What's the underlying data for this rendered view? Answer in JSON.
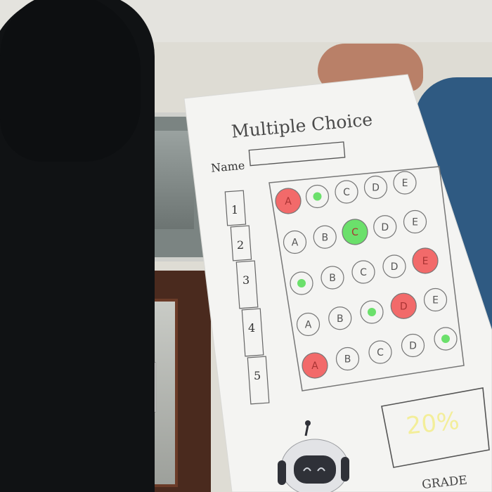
{
  "sheet": {
    "title": "Multiple Choice",
    "name_label": "Name",
    "grade_label": "GRADE",
    "score": "20%"
  },
  "options": [
    "A",
    "B",
    "C",
    "D",
    "E"
  ],
  "questions": [
    "1",
    "2",
    "3",
    "4",
    "5"
  ],
  "answers": [
    {
      "question": "1",
      "marked": "A",
      "correct": "B"
    },
    {
      "question": "2",
      "marked": "C",
      "correct": "C"
    },
    {
      "question": "3",
      "marked": "E",
      "correct": "A"
    },
    {
      "question": "4",
      "marked": "D",
      "correct": "C"
    },
    {
      "question": "5",
      "marked": "A",
      "correct": "E"
    }
  ],
  "colors": {
    "wrong": "#f26a6a",
    "correct": "#6be06b",
    "score_text": "#f3ee9a"
  }
}
